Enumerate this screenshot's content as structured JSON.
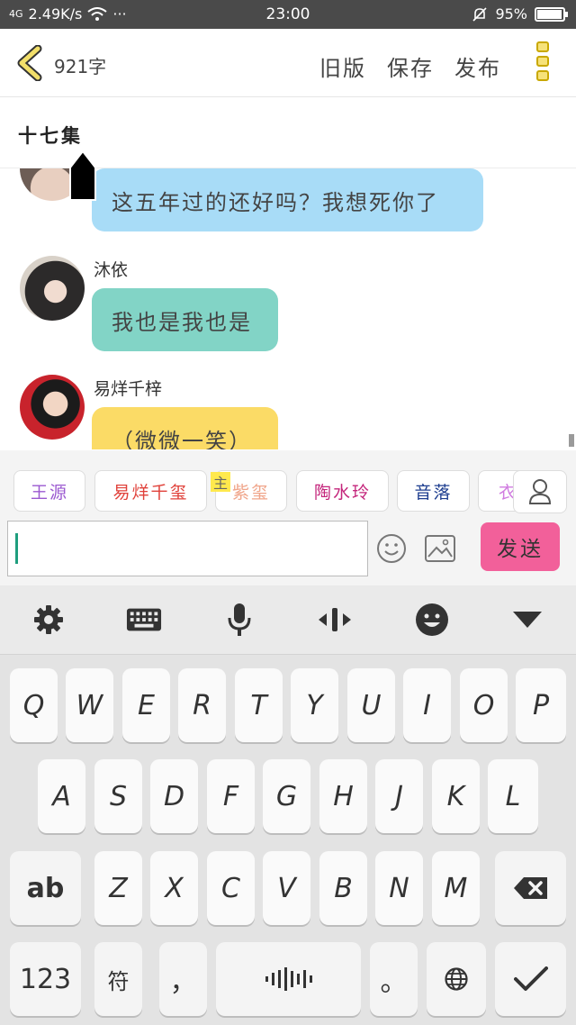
{
  "status_bar": {
    "signal": "4G",
    "speed": "2.49K/s",
    "more": "···",
    "time": "23:00",
    "battery": "95%",
    "battery_level": 0.95
  },
  "header": {
    "word_count": "921字",
    "old_version": "旧版",
    "save": "保存",
    "publish": "发布"
  },
  "chapter_title": "十七集",
  "messages": [
    {
      "name": "",
      "text": "这五年过的还好吗？我想死你了",
      "bubble_color": "#a8dcf7"
    },
    {
      "name": "沐依",
      "text": "我也是我也是",
      "bubble_color": "#82d4c6"
    },
    {
      "name": "易烊千梓",
      "text": "（微微一笑）",
      "bubble_color": "#fbdb66"
    }
  ],
  "characters": [
    {
      "label": "王源",
      "color": "#9b59d0"
    },
    {
      "label": "易烊千玺",
      "color": "#e0413a"
    },
    {
      "label": "紫玺",
      "color": "#f0a58a",
      "badge": "主"
    },
    {
      "label": "陶水玲",
      "color": "#c4257b"
    },
    {
      "label": "音落",
      "color": "#1d3d8f"
    },
    {
      "label": "衣",
      "color": "#d07be0"
    }
  ],
  "input": {
    "value": "",
    "placeholder": ""
  },
  "send_label": "发送",
  "keyboard": {
    "row1": [
      "Q",
      "W",
      "E",
      "R",
      "T",
      "Y",
      "U",
      "I",
      "O",
      "P"
    ],
    "row2": [
      "A",
      "S",
      "D",
      "F",
      "G",
      "H",
      "J",
      "K",
      "L"
    ],
    "row3": [
      "Z",
      "X",
      "C",
      "V",
      "B",
      "N",
      "M"
    ],
    "shift_label": "ab",
    "numbers_label": "123",
    "symbols_label": "符",
    "comma_label": "，",
    "period_label": "。"
  },
  "icons": [
    "back-chevron-icon",
    "menu-dots-icon",
    "person-icon",
    "emoji-icon",
    "image-icon",
    "settings-icon",
    "keyboard-icon",
    "microphone-icon",
    "cursor-move-icon",
    "smiley-icon",
    "collapse-icon",
    "backspace-icon",
    "voice-wave-icon",
    "globe-icon",
    "checkmark-icon"
  ],
  "colors": {
    "send": "#f2609a",
    "accent_yellow": "#f6e27a",
    "caret": "#1e9e7e"
  }
}
